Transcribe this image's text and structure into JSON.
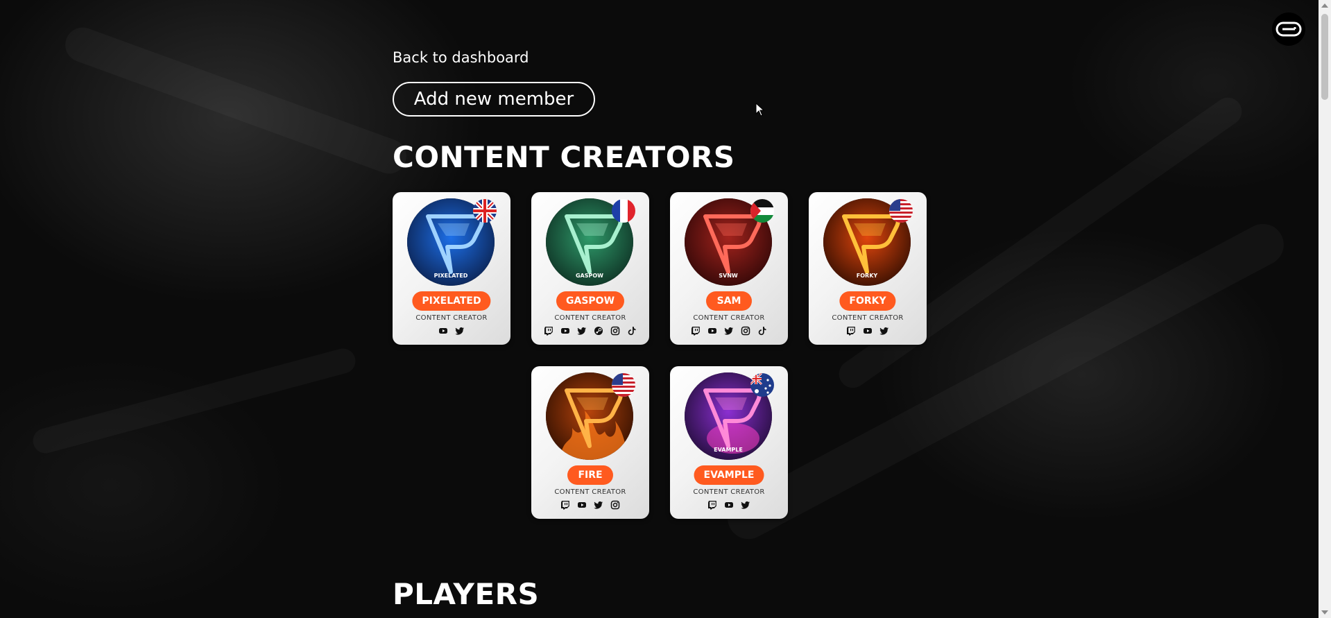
{
  "nav": {
    "back_label": "Back to dashboard"
  },
  "actions": {
    "add_member_label": "Add new member"
  },
  "sections": {
    "content_creators": {
      "title": "CONTENT CREATORS",
      "members": [
        {
          "name": "PIXELATED",
          "role": "CONTENT CREATOR",
          "avatar_text": "PIXELATED",
          "flag": "uk-flag",
          "theme": "blue",
          "socials": [
            "youtube-icon",
            "twitter-icon"
          ]
        },
        {
          "name": "GASPOW",
          "role": "CONTENT CREATOR",
          "avatar_text": "GASPOW",
          "flag": "france-flag",
          "theme": "green",
          "socials": [
            "twitch-icon",
            "youtube-icon",
            "twitter-icon",
            "steam-icon",
            "instagram-icon",
            "tiktok-icon"
          ]
        },
        {
          "name": "SAM",
          "role": "CONTENT CREATOR",
          "avatar_text": "SVNW",
          "flag": "palestine-flag",
          "theme": "red",
          "socials": [
            "twitch-icon",
            "youtube-icon",
            "twitter-icon",
            "instagram-icon",
            "tiktok-icon"
          ]
        },
        {
          "name": "FORKY",
          "role": "CONTENT CREATOR",
          "avatar_text": "FORKY",
          "flag": "usa-flag",
          "theme": "orange",
          "socials": [
            "twitch-icon",
            "youtube-icon",
            "twitter-icon"
          ]
        },
        {
          "name": "FIRE",
          "role": "CONTENT CREATOR",
          "avatar_text": "",
          "flag": "usa-flag",
          "theme": "fire",
          "socials": [
            "twitch-icon",
            "youtube-icon",
            "twitter-icon",
            "instagram-icon"
          ]
        },
        {
          "name": "EVAMPLE",
          "role": "CONTENT CREATOR",
          "avatar_text": "EVAMPLE",
          "flag": "australia-flag",
          "theme": "purple",
          "socials": [
            "twitch-icon",
            "youtube-icon",
            "twitter-icon"
          ]
        }
      ]
    },
    "players": {
      "title": "PLAYERS"
    }
  },
  "colors": {
    "accent": "#ff5a1f",
    "card_bg": "#f3f3f3",
    "page_bg": "#0a0a0a"
  },
  "icons": {
    "brand_logo": "brand-logo-icon"
  }
}
